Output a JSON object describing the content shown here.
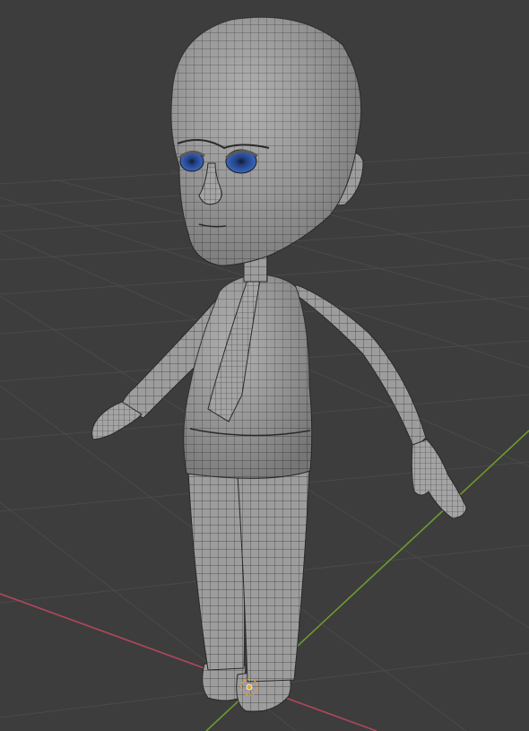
{
  "viewport": {
    "mode": "3d-viewport",
    "shading": "solid",
    "overlay": "wireframe",
    "background_color": "#3d3d3d",
    "grid_line_color": "#4a4a4a",
    "x_axis_color": "#b0485a",
    "y_axis_color": "#6e9a2e",
    "mesh_color": "#9b9b9b",
    "wire_color": "#2a2a2a",
    "eye_iris_color": "#2a4f9a",
    "origin_point_color": "#e8a23a"
  },
  "object": {
    "name_visible": false,
    "type": "character-mesh"
  }
}
